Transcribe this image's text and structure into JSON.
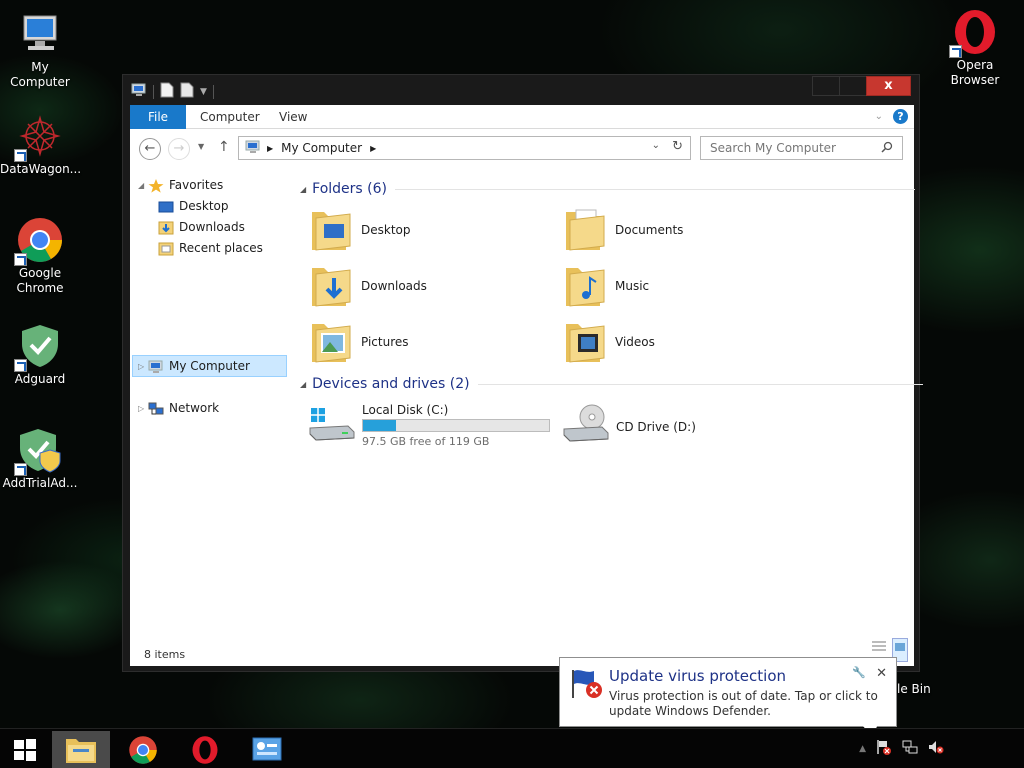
{
  "desktop": {
    "icons": [
      {
        "label": "My Computer"
      },
      {
        "label": "DataWagon..."
      },
      {
        "label": "Google Chrome"
      },
      {
        "label": "Adguard"
      },
      {
        "label": "AddTrialAd..."
      },
      {
        "label": "Opera Browser"
      }
    ],
    "recycle_partial": "le Bin"
  },
  "window": {
    "close_label": "x",
    "ribbon_tabs": [
      "File",
      "Computer",
      "View"
    ],
    "address": "My Computer",
    "search_placeholder": "Search My Computer",
    "nav": {
      "favorites": "Favorites",
      "fav_items": [
        "Desktop",
        "Downloads",
        "Recent places"
      ],
      "computer": "My Computer",
      "network": "Network"
    },
    "folders_header": "Folders (6)",
    "folders": [
      "Desktop",
      "Documents",
      "Downloads",
      "Music",
      "Pictures",
      "Videos"
    ],
    "devices_header": "Devices and drives (2)",
    "drives": [
      {
        "name": "Local Disk (C:)",
        "free": "97.5 GB free of 119 GB",
        "used_fraction": 0.18
      },
      {
        "name": "CD Drive (D:)"
      }
    ],
    "status": "8 items"
  },
  "notification": {
    "title": "Update virus protection",
    "text": "Virus protection is out of date. Tap or click to update Windows Defender."
  },
  "colors": {
    "accent": "#1979ca",
    "close": "#c7372f",
    "header_text": "#1e3287",
    "drive_bar": "#26a0da"
  }
}
